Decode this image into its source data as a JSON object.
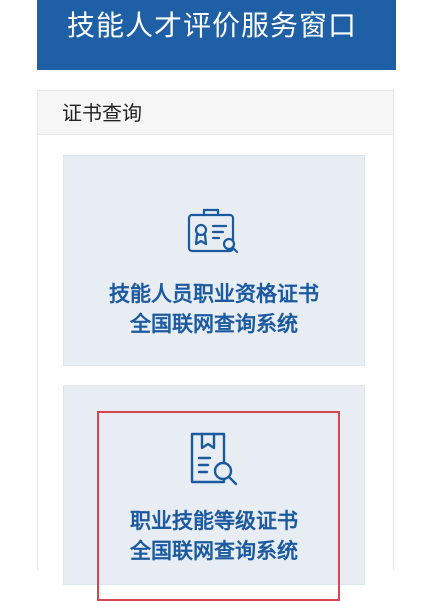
{
  "banner": {
    "title": "技能人才评价服务窗口"
  },
  "panel": {
    "title": "证书查询",
    "cards": [
      {
        "line1": "技能人员职业资格证书",
        "line2": "全国联网查询系统",
        "icon": "certificate-badge-icon"
      },
      {
        "line1": "职业技能等级证书",
        "line2": "全国联网查询系统",
        "icon": "document-search-icon",
        "highlighted": true
      }
    ]
  },
  "colors": {
    "banner_bg": "#1f5fa6",
    "card_bg": "#e8edf4",
    "accent_text": "#1b5aa0",
    "highlight_border": "#d64550"
  }
}
